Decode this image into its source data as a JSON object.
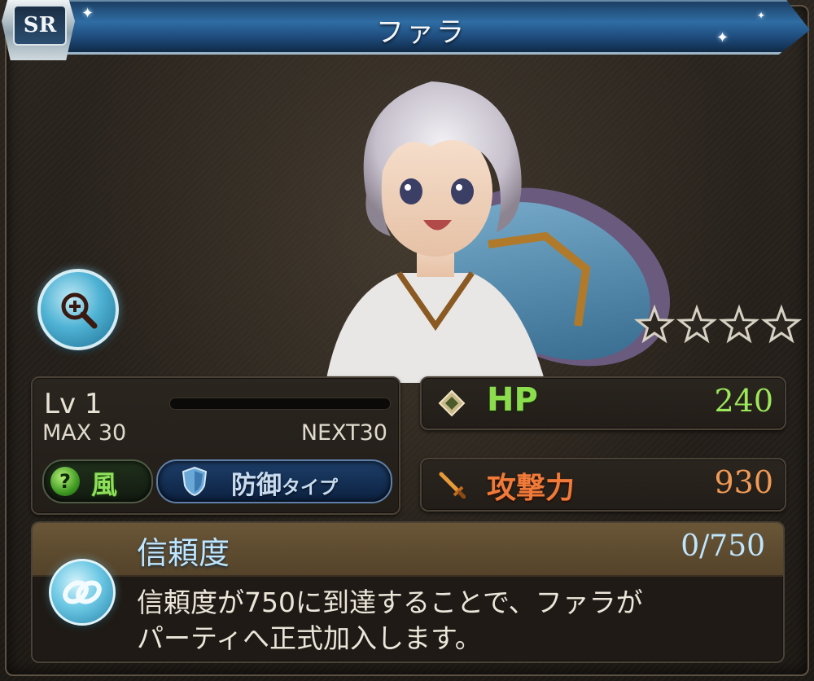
{
  "header": {
    "rarity": "SR",
    "name": "ファラ"
  },
  "colors": {
    "title_bar": "#2f6da4",
    "hp": "#8bdd4e",
    "attack": "#f07a3a",
    "trust": "#bfe6ff",
    "element": "#8ee05a"
  },
  "icons": {
    "zoom": "magnifier-plus-icon",
    "hp": "diamond-icon",
    "attack": "sword-icon",
    "element": "wind-element-icon",
    "type": "shield-icon",
    "trust": "link-icon"
  },
  "character": {
    "stars_total": 4,
    "stars_filled": 0
  },
  "level": {
    "label": "Lv 1",
    "max": "MAX 30",
    "next": "NEXT30",
    "exp_progress": 0
  },
  "element": {
    "icon_glyph": "?",
    "label": "風"
  },
  "type": {
    "label_main": "防御",
    "label_sub": "タイプ"
  },
  "stats": {
    "hp_label": "HP",
    "hp_value": "240",
    "atk_label": "攻撃力",
    "atk_value": "930"
  },
  "trust": {
    "title": "信頼度",
    "value": "0/750",
    "description_line1": "信頼度が750に到達することで、ファラが",
    "description_line2": "パーティへ正式加入します。"
  }
}
